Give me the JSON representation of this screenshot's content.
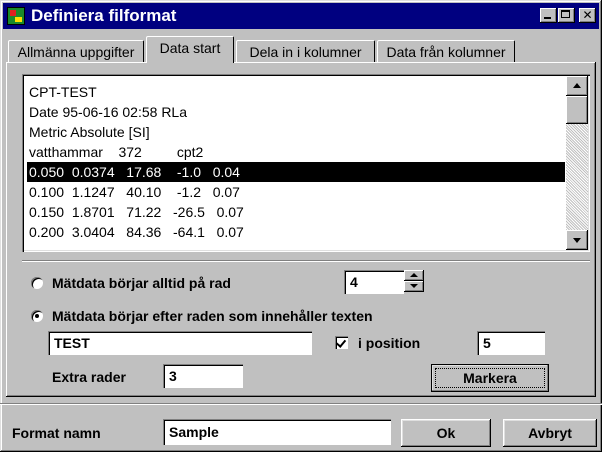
{
  "window": {
    "title": "Definiera filformat",
    "icon": "app-icon",
    "controls": [
      "minimize-icon",
      "maximize-icon",
      "close-icon"
    ],
    "close_glyph": "✕"
  },
  "tabs": [
    {
      "label": "Allmänna uppgifter",
      "active": false
    },
    {
      "label": "Data start",
      "active": true
    },
    {
      "label": "Dela in i kolumner",
      "active": false
    },
    {
      "label": "Data från kolumner",
      "active": false
    }
  ],
  "preview": {
    "lines": [
      "CPT-TEST",
      "Date 95-06-16 02:58 RLa",
      "Metric Absolute [SI]",
      "vatthammar    372         cpt2",
      "0.050  0.0374   17.68    -1.0   0.04",
      "0.100  1.1247   40.10    -1.2   0.07",
      "0.150  1.8701   71.22   -26.5   0.07",
      "0.200  3.0404   84.36   -64.1   0.07"
    ],
    "selected_index": 4
  },
  "options": {
    "radio_row": {
      "label": "Mätdata börjar alltid på rad",
      "value": "4",
      "checked": false
    },
    "radio_text": {
      "label": "Mätdata börjar efter raden som innehåller texten",
      "checked": true
    },
    "text_value": "TEST",
    "position_label": "i position",
    "position_checked": true,
    "position_value": "5",
    "extra_label": "Extra rader",
    "extra_value": "3",
    "mark_button": "Markera"
  },
  "footer": {
    "format_label": "Format namn",
    "format_value": "Sample",
    "ok_button": "Ok",
    "cancel_button": "Avbryt"
  }
}
